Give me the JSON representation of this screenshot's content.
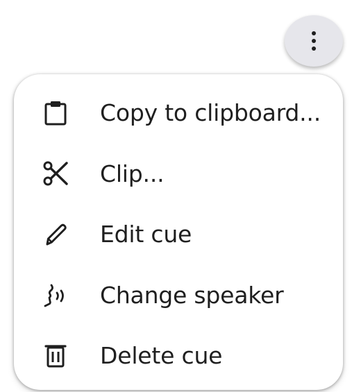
{
  "more_button": {
    "icon": "more-vertical-icon"
  },
  "menu": {
    "items": [
      {
        "label": "Copy to clipboard...",
        "icon": "clipboard-icon"
      },
      {
        "label": "Clip...",
        "icon": "scissors-icon"
      },
      {
        "label": "Edit cue",
        "icon": "pencil-icon"
      },
      {
        "label": "Change speaker",
        "icon": "speaker-icon"
      },
      {
        "label": "Delete cue",
        "icon": "trash-icon"
      }
    ]
  },
  "colors": {
    "text": "#1f1f1f",
    "button_bg": "#e6e6eb",
    "menu_bg": "#ffffff"
  }
}
